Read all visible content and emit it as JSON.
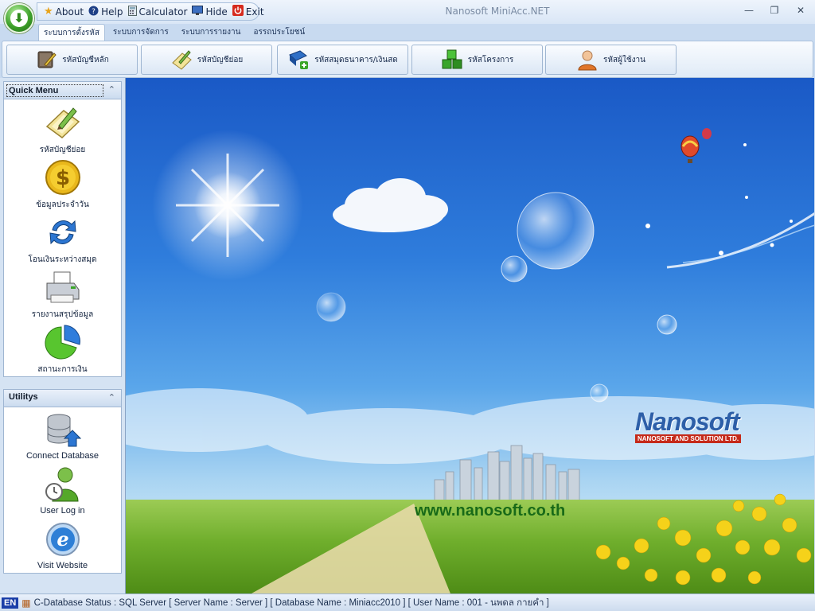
{
  "app": {
    "title": "Nanosoft MiniAcc.NET"
  },
  "quick_access": [
    {
      "label": "About",
      "icon": "star-icon"
    },
    {
      "label": "Help",
      "icon": "help-icon"
    },
    {
      "label": "Calculator",
      "icon": "calculator-icon"
    },
    {
      "label": "Hide",
      "icon": "monitor-icon"
    },
    {
      "label": "Exit",
      "icon": "power-icon"
    }
  ],
  "window_controls": {
    "minimize": "—",
    "restore": "❐",
    "close": "✕"
  },
  "tabs": [
    {
      "label": "ระบบการตั้งรหัส",
      "active": true
    },
    {
      "label": "ระบบการจัดการ",
      "active": false
    },
    {
      "label": "ระบบการรายงาน",
      "active": false
    },
    {
      "label": "อรรถประโยชน์",
      "active": false
    }
  ],
  "ribbon_buttons": [
    {
      "label": "รหัสบัญชีหลัก",
      "icon": "ledger-book-icon"
    },
    {
      "label": "รหัสบัญชีย่อย",
      "icon": "note-pencil-icon"
    },
    {
      "label": "รหัสสมุดธนาคาร/เงินสด",
      "icon": "bank-book-add-icon"
    },
    {
      "label": "รหัสโครงการ",
      "icon": "green-blocks-icon"
    },
    {
      "label": "รหัสผู้ใช้งาน",
      "icon": "user-icon"
    }
  ],
  "quick_menu": {
    "title": "Quick Menu",
    "collapse_glyph": "⌃",
    "items": [
      {
        "label": "รหัสบัญชีย่อย",
        "icon": "note-pencil-icon"
      },
      {
        "label": "ข้อมูลประจำวัน",
        "icon": "dollar-coin-icon"
      },
      {
        "label": "โอนเงินระหว่างสมุด",
        "icon": "transfer-arrows-icon"
      },
      {
        "label": "รายงานสรุปข้อมูล",
        "icon": "printer-icon"
      },
      {
        "label": "สถานะการเงิน",
        "icon": "pie-chart-icon"
      }
    ]
  },
  "utilitys": {
    "title": "Utilitys",
    "collapse_glyph": "⌃",
    "items": [
      {
        "label": "Connect Database",
        "icon": "database-icon"
      },
      {
        "label": "User Log in",
        "icon": "user-clock-icon"
      },
      {
        "label": "Visit Website",
        "icon": "browser-icon"
      }
    ]
  },
  "background": {
    "website": "www.nanosoft.co.th",
    "brand": "Nanosoft",
    "brand_sub": "NANOSOFT AND SOLUTION LTD."
  },
  "status_bar": {
    "lang": "EN",
    "text": "C-Database Status : SQL Server [ Server Name : Server ]  [ Database Name : Miniacc2010 ]  [ User Name : 001 - ",
    "user": "นพดล กายคำ ]"
  },
  "colors": {
    "accent": "#1b3fa8",
    "sky": "#2f7ddc",
    "grass": "#6fae2c",
    "brand_red": "#c52a1a"
  }
}
